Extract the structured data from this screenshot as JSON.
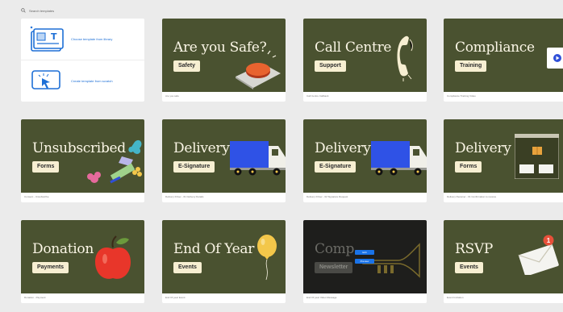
{
  "search": {
    "placeholder": "Search templates"
  },
  "create": {
    "from_library": "Choose template from library",
    "from_scratch": "Create template from scratch"
  },
  "templates": [
    {
      "title": "Are you Safe?",
      "tag": "Safety",
      "caption": "Are you safe"
    },
    {
      "title": "Call Centre",
      "tag": "Support",
      "caption": "Call Centre Callback"
    },
    {
      "title": "Compliance",
      "tag": "Training",
      "caption": "Compliance Training Video"
    },
    {
      "title": "Unsubscribed",
      "tag": "Forms",
      "caption": "Consent - Unsubscribe"
    },
    {
      "title": "Delivery",
      "tag": "E-Signature",
      "caption": "Delivery Driver - 01 Delivery Details"
    },
    {
      "title": "Delivery",
      "tag": "E-Signature",
      "caption": "Delivery Driver - 02 Signature Request"
    },
    {
      "title": "Delivery",
      "tag": "Forms",
      "caption": "Delivery Receiver - 01 Confirmation to receive"
    },
    {
      "title": "Donation",
      "tag": "Payments",
      "caption": "Donation - Payment"
    },
    {
      "title": "End Of Year",
      "tag": "Events",
      "caption": "End Of year Event"
    },
    {
      "title": "Comp",
      "tag": "Newsletter",
      "caption": "End Of year Video Message",
      "tooltips": [
        "Edit",
        "Preview"
      ]
    },
    {
      "title": "RSVP",
      "tag": "Events",
      "caption": "Event Invitation"
    }
  ],
  "icons": [
    "search-icon",
    "template-library-icon",
    "cursor-click-icon",
    "sign-icon",
    "phone-icon",
    "video-play-icon",
    "flower-icon",
    "ruler-icon",
    "truck-icon",
    "form-window-icon",
    "apple-icon",
    "balloon-icon",
    "trumpet-icon",
    "envelope-icon",
    "notification-badge-icon"
  ],
  "badge_count": "1",
  "colors": {
    "card_green": "#4a5230",
    "pill_cream": "#f7efd2",
    "title_cream": "#fbf6e6",
    "link_blue": "#1d6fd6",
    "truck_blue": "#2f52e6",
    "badge_red": "#e8503a"
  }
}
